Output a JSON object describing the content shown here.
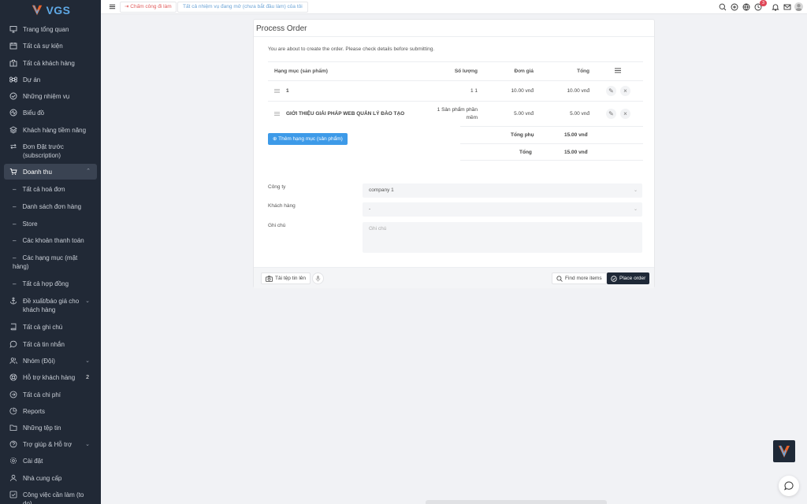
{
  "brand": {
    "name": "VGS"
  },
  "sidebar": {
    "items": [
      {
        "label": "Trang tổng quan",
        "icon": "monitor-icon"
      },
      {
        "label": "Tất cả sự kiện",
        "icon": "calendar-icon"
      },
      {
        "label": "Tất cả khách hàng",
        "icon": "briefcase-icon"
      },
      {
        "label": "Dự án",
        "icon": "command-icon"
      },
      {
        "label": "Những nhiệm vụ",
        "icon": "check-circle-icon"
      },
      {
        "label": "Biểu đồ",
        "icon": "activity-icon"
      },
      {
        "label": "Khách hàng tiềm năng",
        "icon": "layers-icon"
      },
      {
        "label": "Đơn Đặt trước (subscription)",
        "icon": "repeat-icon"
      },
      {
        "label": "Doanh thu",
        "icon": "cart-icon"
      }
    ],
    "revenue_sub": [
      "Tất cả hoá đơn",
      "Danh sách đơn hàng",
      "Store",
      "Các khoản thanh toán",
      "Các hạng mục (mặt hàng)",
      "Tất cả hợp đồng"
    ],
    "items2": [
      {
        "label": "Đề xuất/báo giá cho khách hàng",
        "icon": "anchor-icon"
      },
      {
        "label": "Tất cả ghi chú",
        "icon": "book-icon"
      },
      {
        "label": "Tất cả tin nhắn",
        "icon": "message-icon"
      },
      {
        "label": "Nhóm (Đội)",
        "icon": "users-icon"
      },
      {
        "label": "Hỗ trợ khách hàng",
        "icon": "lifebuoy-icon",
        "badge": "2"
      },
      {
        "label": "Tất cả chi phí",
        "icon": "arrow-circle-icon"
      },
      {
        "label": "Reports",
        "icon": "pie-chart-icon"
      },
      {
        "label": "Những tệp tin",
        "icon": "folder-icon"
      },
      {
        "label": "Trợ giúp & Hỗ trợ",
        "icon": "help-circle-icon"
      },
      {
        "label": "Cài đặt",
        "icon": "settings-icon"
      },
      {
        "label": "Nhà cung cấp",
        "icon": "user-icon"
      },
      {
        "label": "Công việc cần làm (to do)",
        "icon": "check-square-icon"
      }
    ]
  },
  "topbar": {
    "clock_in": "Chấm công đi làm",
    "tasks_link": "Tất cả nhiệm vụ đang mở (chưa bắt đầu làm) của tôi",
    "notification_badge": "3"
  },
  "panel": {
    "title": "Process Order",
    "intro": "You are about to create the order. Please check details before submitting.",
    "columns": {
      "item": "Hạng mục (sản phẩm)",
      "qty": "Số lượng",
      "rate": "Đơn giá",
      "total": "Tổng"
    },
    "rows": [
      {
        "name": "1",
        "qty": "1 1",
        "rate": "10.00 vnđ",
        "total": "10.00 vnđ"
      },
      {
        "name": "GIỚI THIỆU GIẢI PHÁP WEB QUẢN LÝ ĐÀO TẠO",
        "qty": "1 Sản phẩm phần mềm",
        "rate": "5.00 vnđ",
        "total": "5.00 vnđ"
      }
    ],
    "add_item": "Thêm hạng mục (sản phẩm)",
    "subtotal_label": "Tổng phụ",
    "subtotal_value": "15.00 vnđ",
    "total_label": "Tổng",
    "total_value": "15.00 vnđ",
    "form": {
      "company_label": "Công ty",
      "company_value": "company 1",
      "client_label": "Khách hàng",
      "client_value": "-",
      "note_label": "Ghi chú",
      "note_placeholder": "Ghi chú"
    },
    "footer": {
      "upload": "Tải tệp tin lên",
      "find_more": "Find more items",
      "place_order": "Place order"
    }
  },
  "colors": {
    "sidebar_bg": "#212936",
    "primary": "#3d9ae8",
    "danger": "#e05a5a",
    "dark_button": "#1f2937"
  }
}
